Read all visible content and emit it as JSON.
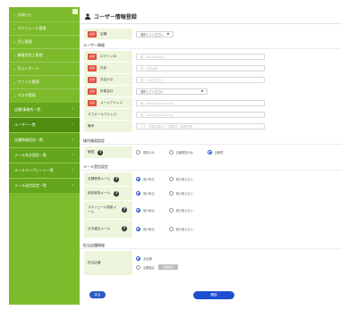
{
  "colors": {
    "sidebar": "#7dbb2c",
    "sidebar_sub": "#64a61c",
    "label_bg": "#edf6dc",
    "required": "#e2503f",
    "primary": "#2b59c3"
  },
  "sidebar": {
    "items": [
      {
        "label": "お知らせ"
      },
      {
        "label": "スケジュール管理"
      },
      {
        "label": "売上管理"
      },
      {
        "label": "顧客別売上管理"
      },
      {
        "label": "売上レポート"
      },
      {
        "label": "ファイル管理"
      },
      {
        "label": "マスタ管理"
      }
    ],
    "sub_items": [
      {
        "label": "店舗/事業所一覧"
      },
      {
        "label": "ユーザー一覧"
      },
      {
        "label": "店舗情報設定一覧"
      },
      {
        "label": "メール本文設定一覧"
      },
      {
        "label": "メールテンプレート一覧"
      },
      {
        "label": "メール送信設定一覧"
      }
    ]
  },
  "page": {
    "title": "ユーザー情報登録"
  },
  "store": {
    "label": "店舗",
    "required": "必須",
    "select": "選択してください"
  },
  "user_info": {
    "section": "ユーザー情報",
    "required": "必須",
    "rows": [
      {
        "label": "ログインID",
        "placeholder": "例：xxx.xxxxxxx",
        "required": true
      },
      {
        "label": "氏名",
        "placeholder": "例：山田太郎",
        "required": true
      },
      {
        "label": "氏名かな",
        "placeholder": "例：やまだたろう",
        "required": true
      },
      {
        "label": "所属会社",
        "select": "選択してください",
        "required": true
      },
      {
        "label": "メールアドレス",
        "placeholder": "例：xxx@xxxxxxx.co.jp",
        "required": true
      },
      {
        "label": "サブメールアドレス",
        "placeholder": "例：xxx@xxxxxxx.co.jp",
        "required": false
      },
      {
        "label": "備考",
        "placeholder": "メモ・業務内容など（部署名・連絡先等）",
        "required": false
      }
    ]
  },
  "permission": {
    "section": "操作権限設定",
    "label": "権限",
    "options": [
      "閲覧のみ",
      "店舗運営のみ",
      "全権限"
    ],
    "selected": 2
  },
  "mail": {
    "section": "メール受信設定",
    "rows": [
      {
        "label": "店舗登録メール",
        "options": [
          "受け取る",
          "受け取らない"
        ],
        "selected": 0,
        "help": true
      },
      {
        "label": "削除登録メール",
        "options": [
          "受け取る",
          "受け取らない"
        ],
        "selected": 0,
        "help": true
      },
      {
        "label": "スケジュール更新メール",
        "options": [
          "受け取る",
          "受け取らない"
        ],
        "selected": 0,
        "help": true
      },
      {
        "label": "日次報告メール",
        "options": [
          "受け取る",
          "受け取らない"
        ],
        "selected": 0,
        "help": true
      }
    ]
  },
  "email_status": {
    "section": "担当店舗情報",
    "label": "担当店舗",
    "options": [
      "全店舗",
      "店舗指定"
    ],
    "selected": 0,
    "button": "店舗選択"
  },
  "buttons": {
    "back": "戻る",
    "confirm": "確認"
  },
  "help_glyph": "?"
}
